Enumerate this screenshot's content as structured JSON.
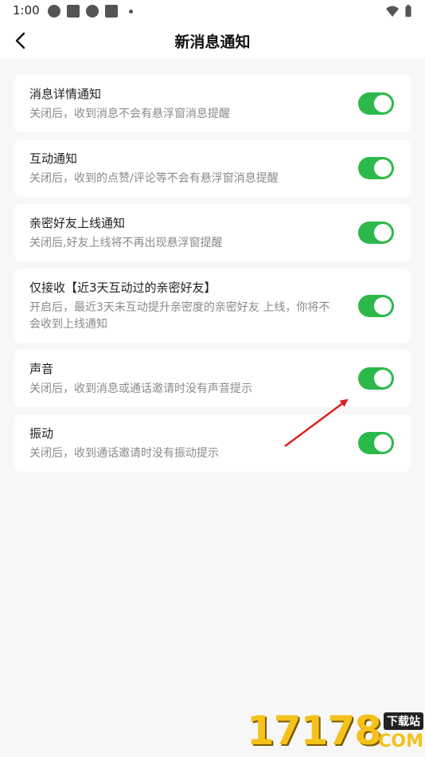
{
  "status_bar": {
    "time": "1:00",
    "icons": [
      "app-notification-icon",
      "square-notification-icon",
      "app-notification-icon",
      "square-notification-icon",
      "more-dot-icon",
      "wifi-icon",
      "battery-icon"
    ]
  },
  "header": {
    "title": "新消息通知",
    "back_icon": "chevron-left-icon"
  },
  "settings": [
    {
      "title": "消息详情通知",
      "desc": "关闭后，收到消息不会有悬浮窗消息提醒",
      "enabled": true
    },
    {
      "title": "互动通知",
      "desc": "关闭后，收到的点赞/评论等不会有悬浮窗消息提醒",
      "enabled": true
    },
    {
      "title": "亲密好友上线通知",
      "desc": "关闭后,好友上线将不再出现悬浮窗提醒",
      "enabled": true
    },
    {
      "title": "仅接收【近3天互动过的亲密好友】",
      "desc": "开启后，最近3天未互动提升亲密度的亲密好友 上线，你将不会收到上线通知",
      "enabled": true
    },
    {
      "title": "声音",
      "desc": "关闭后，收到消息或通话邀请时没有声音提示",
      "enabled": true
    },
    {
      "title": "振动",
      "desc": "关闭后，收到通话邀请时没有振动提示",
      "enabled": true
    }
  ],
  "colors": {
    "toggle_on": "#2db84b",
    "annotation_arrow": "#e02020"
  },
  "watermark": {
    "number": "17178",
    "badge": "下载站",
    "suffix": "COM"
  }
}
